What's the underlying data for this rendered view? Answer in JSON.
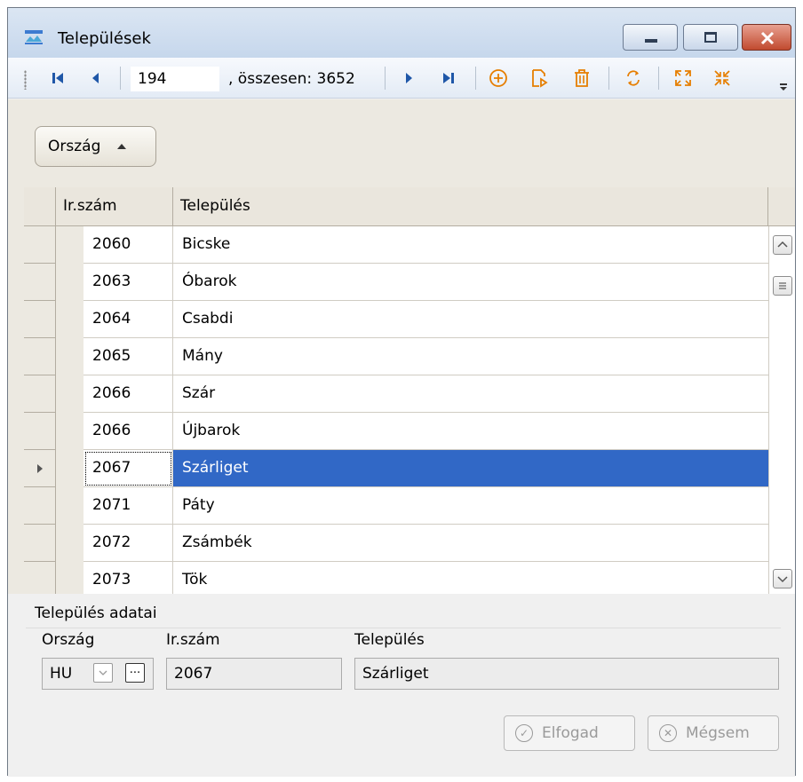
{
  "window": {
    "title": "Települések"
  },
  "toolbar": {
    "position": "194",
    "total_label": ", összesen: 3652"
  },
  "group": {
    "label": "Ország"
  },
  "grid": {
    "columns": [
      "Ir.szám",
      "Település"
    ],
    "rows": [
      {
        "zip": "2060",
        "name": "Bicske"
      },
      {
        "zip": "2063",
        "name": "Óbarok"
      },
      {
        "zip": "2064",
        "name": "Csabdi"
      },
      {
        "zip": "2065",
        "name": "Mány"
      },
      {
        "zip": "2066",
        "name": "Szár"
      },
      {
        "zip": "2066",
        "name": "Újbarok"
      },
      {
        "zip": "2067",
        "name": "Szárliget"
      },
      {
        "zip": "2071",
        "name": "Páty"
      },
      {
        "zip": "2072",
        "name": "Zsámbék"
      },
      {
        "zip": "2073",
        "name": "Tök"
      }
    ],
    "selected_index": 6
  },
  "details": {
    "title": "Település adatai",
    "country_label": "Ország",
    "zip_label": "Ir.szám",
    "name_label": "Település",
    "country_value": "HU",
    "zip_value": "2067",
    "name_value": "Szárliget",
    "accept_label": "Elfogad",
    "cancel_label": "Mégsem"
  },
  "colors": {
    "selection": "#3168c6",
    "accent": "#e67e00",
    "nav": "#1f57a8"
  },
  "icons": [
    "first-icon",
    "prev-icon",
    "next-icon",
    "last-icon",
    "add-icon",
    "edit-icon",
    "delete-icon",
    "refresh-icon",
    "expand-icon",
    "collapse-icon"
  ]
}
